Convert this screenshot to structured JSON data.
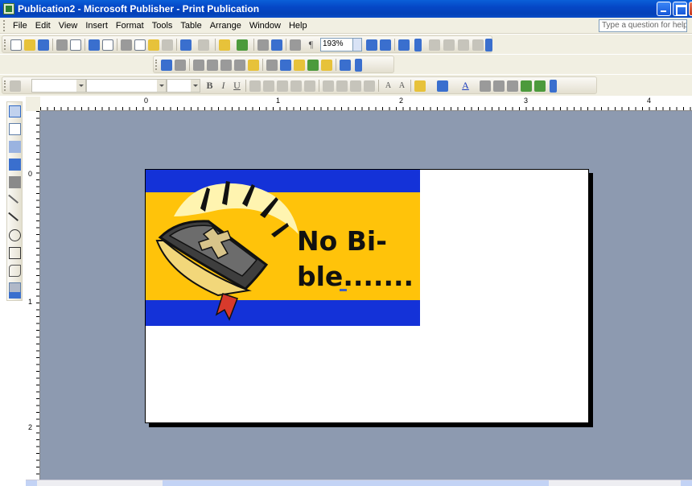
{
  "window": {
    "title": "Publication2 - Microsoft Publisher - Print Publication"
  },
  "menubar": {
    "items": [
      "File",
      "Edit",
      "View",
      "Insert",
      "Format",
      "Tools",
      "Table",
      "Arrange",
      "Window",
      "Help"
    ],
    "ask_placeholder": "Type a question for help"
  },
  "toolbar": {
    "zoom": "193%"
  },
  "ruler": {
    "h_numbers": [
      "0",
      "1",
      "2",
      "3",
      "4"
    ],
    "v_numbers": [
      "0",
      "1",
      "2"
    ]
  },
  "publication": {
    "heading": "No Bi-",
    "heading_line2": "ble.......",
    "band_colors": {
      "blue": "#1432d8",
      "gold": "#ffc30a"
    }
  },
  "icons": {
    "objects": [
      "pointer-icon",
      "text-box-icon",
      "table-icon",
      "wordart-icon",
      "picture-icon",
      "line-icon",
      "arrow-icon",
      "oval-icon",
      "rectangle-icon",
      "autoshapes-icon",
      "design-gallery-icon"
    ]
  }
}
